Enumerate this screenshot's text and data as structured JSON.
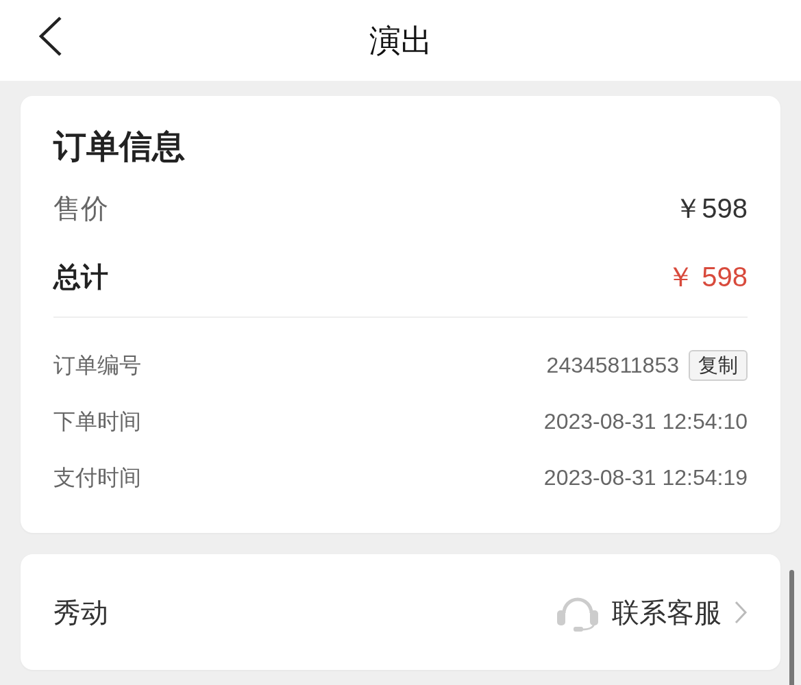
{
  "header": {
    "title": "演出"
  },
  "order": {
    "title": "订单信息",
    "price": {
      "label": "售价",
      "value": "￥598"
    },
    "total": {
      "label": "总计",
      "value": "￥ 598"
    },
    "details": [
      {
        "label": "订单编号",
        "value": "24345811853",
        "action": "复制"
      },
      {
        "label": "下单时间",
        "value": "2023-08-31 12:54:10"
      },
      {
        "label": "支付时间",
        "value": "2023-08-31 12:54:19"
      }
    ]
  },
  "contact": {
    "organizer": "秀动",
    "link": "联系客服"
  }
}
